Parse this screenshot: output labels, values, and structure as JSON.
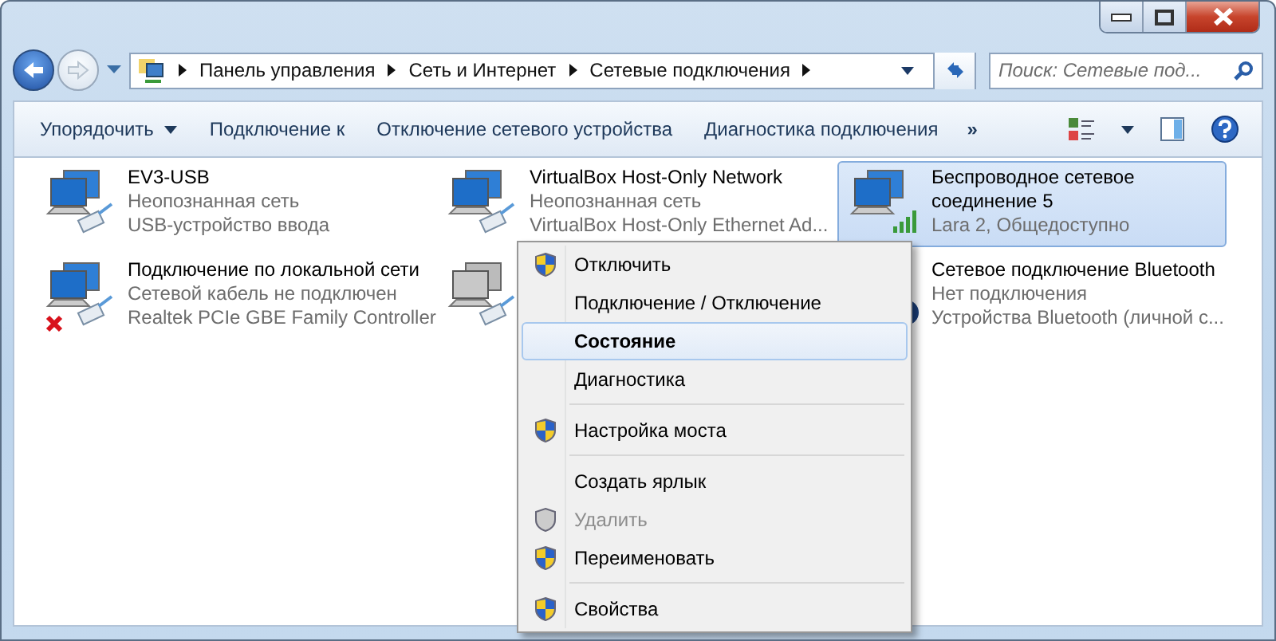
{
  "address_bar": {
    "crumbs": [
      "Панель управления",
      "Сеть и Интернет",
      "Сетевые подключения"
    ]
  },
  "search": {
    "placeholder": "Поиск: Сетевые под..."
  },
  "toolbar": {
    "items": [
      {
        "label": "Упорядочить",
        "dropdown": true
      },
      {
        "label": "Подключение к",
        "dropdown": false
      },
      {
        "label": "Отключение сетевого устройства",
        "dropdown": false
      },
      {
        "label": "Диагностика подключения",
        "dropdown": false
      }
    ],
    "more": "»"
  },
  "connections": [
    {
      "name": "EV3-USB",
      "status": "Неопознанная сеть",
      "device": "USB-устройство ввода",
      "kind": "wired",
      "selected": false,
      "disconnected": false
    },
    {
      "name": "VirtualBox Host-Only Network",
      "status": "Неопознанная сеть",
      "device": "VirtualBox Host-Only Ethernet Ad...",
      "kind": "wired",
      "selected": false,
      "disconnected": false
    },
    {
      "name": "Беспроводное сетевое соединение 5",
      "status": "Lara  2, Общедоступно",
      "kind": "wireless",
      "selected": true,
      "disconnected": false
    },
    {
      "name": "Подключение по локальной сети",
      "status": "Сетевой кабель не подключен",
      "device": "Realtek PCIe GBE Family Controller",
      "kind": "wired",
      "selected": false,
      "disconnected": true
    },
    {
      "kind": "disabled",
      "selected": false
    },
    {
      "name": "Сетевое подключение Bluetooth",
      "status": "Нет подключения",
      "device": "Устройства Bluetooth (личной с...",
      "kind": "bluetooth",
      "selected": false
    }
  ],
  "context_menu": {
    "items": [
      {
        "kind": "item",
        "label": "Отключить",
        "shield": true,
        "selected": false,
        "default": false,
        "disabled": false
      },
      {
        "kind": "item",
        "label": "Подключение / Отключение",
        "shield": false,
        "selected": false,
        "default": false,
        "disabled": false
      },
      {
        "kind": "item",
        "label": "Состояние",
        "shield": false,
        "selected": true,
        "default": true,
        "disabled": false
      },
      {
        "kind": "item",
        "label": "Диагностика",
        "shield": false,
        "selected": false,
        "default": false,
        "disabled": false
      },
      {
        "kind": "separator"
      },
      {
        "kind": "item",
        "label": "Настройка моста",
        "shield": true,
        "selected": false,
        "default": false,
        "disabled": false
      },
      {
        "kind": "separator"
      },
      {
        "kind": "item",
        "label": "Создать ярлык",
        "shield": false,
        "selected": false,
        "default": false,
        "disabled": false
      },
      {
        "kind": "item",
        "label": "Удалить",
        "shield": true,
        "selected": false,
        "default": false,
        "disabled": true
      },
      {
        "kind": "item",
        "label": "Переименовать",
        "shield": true,
        "selected": false,
        "default": false,
        "disabled": false
      },
      {
        "kind": "separator"
      },
      {
        "kind": "item",
        "label": "Свойства",
        "shield": true,
        "selected": false,
        "default": false,
        "disabled": false
      }
    ]
  }
}
